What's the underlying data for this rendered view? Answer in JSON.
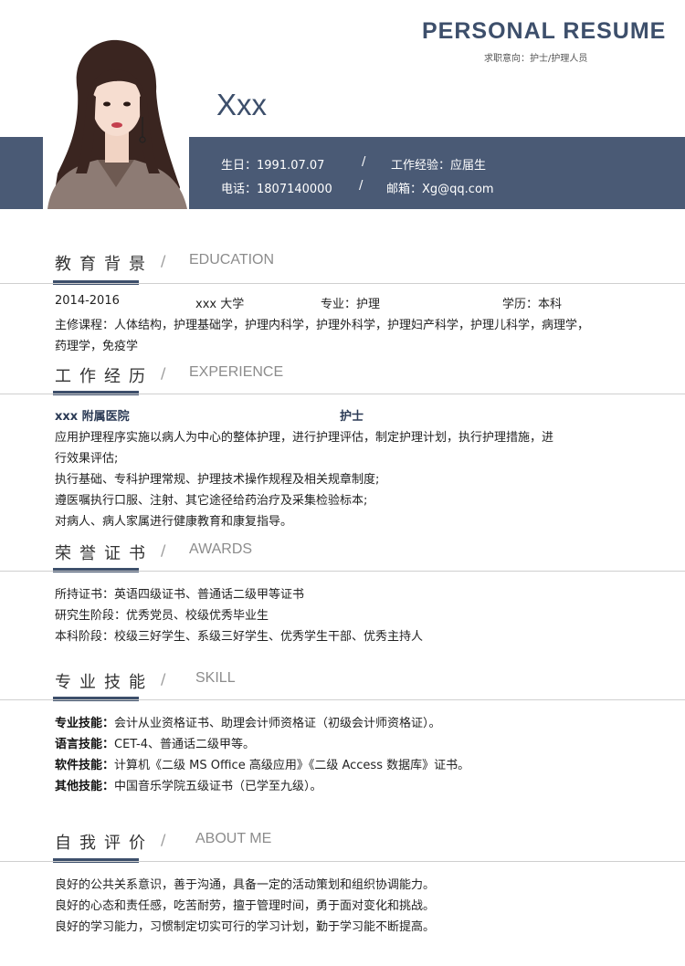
{
  "header": {
    "title": "PERSONAL RESUME",
    "subtitle": "求职意向：护士/护理人员",
    "name": "Xxx"
  },
  "info": {
    "birthday": "生日：1991.07.07",
    "experience": "工作经验：应届生",
    "phone": "电话：1807140000",
    "email": "邮箱：Xg@qq.com",
    "slash": "/"
  },
  "education": {
    "title": "教育背景",
    "title_en": "EDUCATION",
    "period": "2014-2016",
    "school": "xxx 大学",
    "major": "专业：护理",
    "degree": "学历：本科",
    "courses_1": "主修课程：人体结构，护理基础学，护理内科学，护理外科学，护理妇产科学，护理儿科学，病理学，",
    "courses_2": "药理学，免疫学"
  },
  "experience": {
    "title": "工作经历",
    "title_en": "EXPERIENCE",
    "company": "xxx 附属医院",
    "position": "护士",
    "lines": [
      "应用护理程序实施以病人为中心的整体护理，进行护理评估，制定护理计划，执行护理措施，进",
      "行效果评估;",
      "执行基础、专科护理常规、护理技术操作规程及相关规章制度;",
      "遵医嘱执行口服、注射、其它途径给药治疗及采集检验标本;",
      "对病人、病人家属进行健康教育和康复指导。"
    ]
  },
  "awards": {
    "title": "荣誉证书",
    "title_en": "AWARDS",
    "lines": [
      "所持证书：英语四级证书、普通话二级甲等证书",
      "研究生阶段：优秀党员、校级优秀毕业生",
      "本科阶段：校级三好学生、系级三好学生、优秀学生干部、优秀主持人"
    ]
  },
  "skills": {
    "title": "专业技能",
    "title_en": "SKILL",
    "items": [
      {
        "label": "专业技能：",
        "text": "会计从业资格证书、助理会计师资格证（初级会计师资格证）。"
      },
      {
        "label": "语言技能：",
        "text": "CET-4、普通话二级甲等。"
      },
      {
        "label": "软件技能：",
        "text": "计算机《二级 MS Office 高级应用》《二级 Access 数据库》证书。"
      },
      {
        "label": "其他技能：",
        "text": "中国音乐学院五级证书（已学至九级）。"
      }
    ]
  },
  "about": {
    "title": "自我评价",
    "title_en": "ABOUT ME",
    "lines": [
      "良好的公共关系意识，善于沟通，具备一定的活动策划和组织协调能力。",
      "良好的心态和责任感，吃苦耐劳，擅于管理时间，勇于面对变化和挑战。",
      "良好的学习能力，习惯制定切实可行的学习计划，勤于学习能不断提高。"
    ]
  },
  "colors": {
    "accent": "#3d4f6b",
    "band": "#4a5a75"
  }
}
